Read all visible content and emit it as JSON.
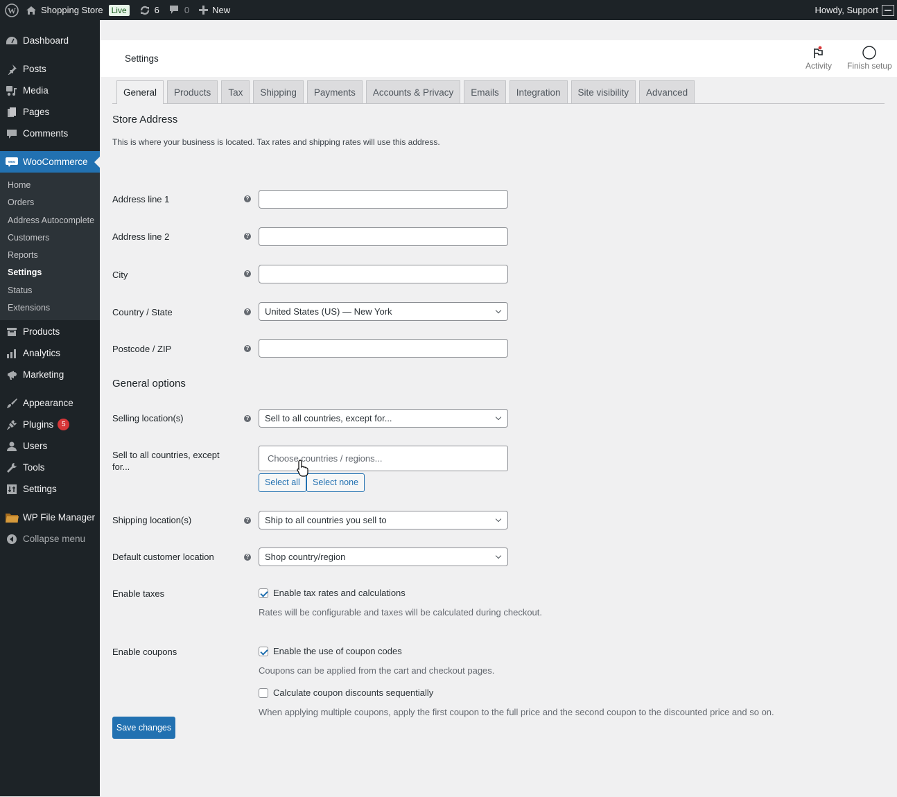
{
  "adminbar": {
    "site_name": "Shopping Store",
    "live_badge": "Live",
    "updates_count": "6",
    "comments_count": "0",
    "new_label": "New",
    "greeting": "Howdy, Support"
  },
  "sidebar": {
    "items_top": [
      {
        "label": "Dashboard",
        "icon": "dashboard-icon"
      },
      {
        "label": "Posts",
        "icon": "pin-icon"
      },
      {
        "label": "Media",
        "icon": "media-icon"
      },
      {
        "label": "Pages",
        "icon": "pages-icon"
      },
      {
        "label": "Comments",
        "icon": "comment-icon"
      }
    ],
    "woocommerce_label": "WooCommerce",
    "woo_submenu": [
      "Home",
      "Orders",
      "Address Autocomplete",
      "Customers",
      "Reports",
      "Settings",
      "Status",
      "Extensions"
    ],
    "woo_current": "Settings",
    "items_mid": [
      {
        "label": "Products",
        "icon": "archive-icon"
      },
      {
        "label": "Analytics",
        "icon": "bar-chart-icon"
      },
      {
        "label": "Marketing",
        "icon": "megaphone-icon"
      }
    ],
    "items_bottom": [
      {
        "label": "Appearance",
        "icon": "paintbrush-icon"
      },
      {
        "label": "Plugins",
        "icon": "plugin-icon",
        "badge": "5"
      },
      {
        "label": "Users",
        "icon": "user-icon"
      },
      {
        "label": "Tools",
        "icon": "wrench-icon"
      },
      {
        "label": "Settings",
        "icon": "settings-icon"
      }
    ],
    "file_manager_label": "WP File Manager",
    "collapse_label": "Collapse menu"
  },
  "header": {
    "title": "Settings",
    "activity_label": "Activity",
    "finish_setup_label": "Finish setup"
  },
  "tabs": [
    "General",
    "Products",
    "Tax",
    "Shipping",
    "Payments",
    "Accounts & Privacy",
    "Emails",
    "Integration",
    "Site visibility",
    "Advanced"
  ],
  "active_tab": "General",
  "store_address": {
    "heading": "Store Address",
    "description": "This is where your business is located. Tax rates and shipping rates will use this address.",
    "fields": [
      {
        "label": "Address line 1",
        "value": ""
      },
      {
        "label": "Address line 2",
        "value": ""
      },
      {
        "label": "City",
        "value": ""
      },
      {
        "label": "Country / State",
        "value": "United States (US) — New York"
      },
      {
        "label": "Postcode / ZIP",
        "value": ""
      }
    ]
  },
  "general_options": {
    "heading": "General options",
    "selling_location": {
      "label": "Selling location(s)",
      "value": "Sell to all countries, except for..."
    },
    "except_for": {
      "label": "Sell to all countries, except for...",
      "placeholder": "Choose countries / regions...",
      "select_all": "Select all",
      "select_none": "Select none"
    },
    "shipping_location": {
      "label": "Shipping location(s)",
      "value": "Ship to all countries you sell to"
    },
    "default_location": {
      "label": "Default customer location",
      "value": "Shop country/region"
    },
    "taxes": {
      "label": "Enable taxes",
      "checkbox": "Enable tax rates and calculations",
      "checked": true,
      "hint": "Rates will be configurable and taxes will be calculated during checkout."
    },
    "coupons": {
      "label": "Enable coupons",
      "checkbox": "Enable the use of coupon codes",
      "checked": true,
      "hint": "Coupons can be applied from the cart and checkout pages.",
      "sequential_checkbox": "Calculate coupon discounts sequentially",
      "sequential_checked": false,
      "sequential_hint": "When applying multiple coupons, apply the first coupon to the full price and the second coupon to the discounted price and so on."
    }
  },
  "save_label": "Save changes",
  "colors": {
    "accent": "#2271b1",
    "adminbar": "#1d2327",
    "badge": "#d63638"
  }
}
